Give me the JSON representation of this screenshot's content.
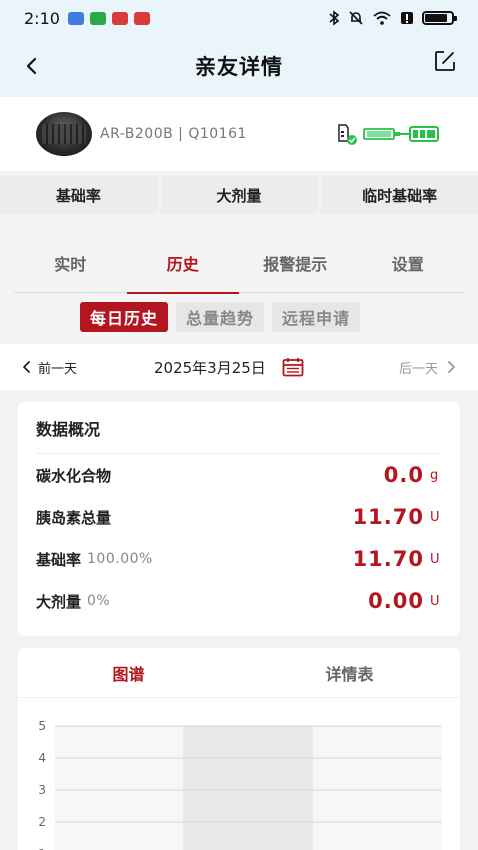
{
  "status_bar": {
    "time": "2:10"
  },
  "header": {
    "title": "亲友详情"
  },
  "device": {
    "info": "AR-B200B | Q10161"
  },
  "quick_actions": [
    "基础率",
    "大剂量",
    "临时基础率"
  ],
  "tabs": [
    "实时",
    "历史",
    "报警提示",
    "设置"
  ],
  "active_tab": "历史",
  "subtabs": [
    "每日历史",
    "总量趋势",
    "远程申请"
  ],
  "active_subtab": "每日历史",
  "date_bar": {
    "prev_label": "前一天",
    "date": "2025年3月25日",
    "next_label": "后一天"
  },
  "summary": {
    "title": "数据概况",
    "rows": [
      {
        "label": "碳水化合物",
        "sub": "",
        "value": "0.0",
        "unit": "g"
      },
      {
        "label": "胰岛素总量",
        "sub": "",
        "value": "11.70",
        "unit": "U"
      },
      {
        "label": "基础率",
        "sub": "100.00%",
        "value": "11.70",
        "unit": "U"
      },
      {
        "label": "大剂量",
        "sub": "0%",
        "value": "0.00",
        "unit": "U"
      }
    ]
  },
  "chart_tabs": [
    "图谱",
    "详情表"
  ],
  "colors": {
    "accent": "#b4161f",
    "header_bg": "#eaf4fb",
    "battery_green": "#27c24c"
  },
  "chart_data": {
    "type": "bar",
    "y_ticks": [
      "5",
      "4",
      "3",
      "2",
      "1"
    ],
    "ylim": [
      0,
      5
    ],
    "grid": true
  }
}
